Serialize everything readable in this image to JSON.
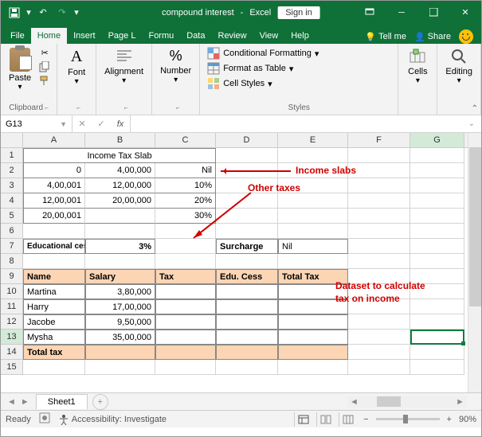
{
  "title": {
    "doc": "compound interest",
    "app": "Excel",
    "signin": "Sign in"
  },
  "tabs": {
    "file": "File",
    "home": "Home",
    "insert": "Insert",
    "pagel": "Page L",
    "formu": "Formu",
    "data": "Data",
    "review": "Review",
    "view": "View",
    "help": "Help",
    "tellme": "Tell me",
    "share": "Share"
  },
  "ribbon": {
    "clipboard": {
      "label": "Clipboard",
      "paste": "Paste"
    },
    "font": {
      "label": "Font"
    },
    "alignment": {
      "label": "Alignment"
    },
    "number": {
      "label": "Number"
    },
    "styles": {
      "label": "Styles",
      "cond": "Conditional Formatting",
      "table": "Format as Table",
      "cell": "Cell Styles"
    },
    "cells": {
      "label": "Cells"
    },
    "editing": {
      "label": "Editing"
    }
  },
  "namebox": "G13",
  "cols": {
    "A": 78,
    "B": 88,
    "C": 76,
    "D": 78,
    "E": 88,
    "F": 78,
    "G": 68
  },
  "rows": 15,
  "activeRow": 13,
  "activeCol": "G",
  "cellData": {
    "merge1": "Income Tax Slab",
    "A2": "0",
    "B2": "4,00,000",
    "C2": "Nil",
    "A3": "4,00,001",
    "B3": "12,00,000",
    "C3": "10%",
    "A4": "12,00,001",
    "B4": "20,00,000",
    "C4": "20%",
    "A5": "20,00,001",
    "C5": "30%",
    "A7": "Educational cess",
    "B7": "3%",
    "D7": "Surcharge",
    "E7": "Nil",
    "A9": "Name",
    "B9": "Salary",
    "C9": "Tax",
    "D9": "Edu. Cess",
    "E9": "Total Tax",
    "A10": "Martina",
    "B10": "3,80,000",
    "A11": "Harry",
    "B11": "17,00,000",
    "A12": "Jacobe",
    "B12": "9,50,000",
    "A13": "Mysha",
    "B13": "35,00,000",
    "A14": "Total tax"
  },
  "annotations": {
    "slabs": "Income slabs",
    "other": "Other taxes",
    "dataset": "Dataset to calculate tax on income"
  },
  "sheetTab": "Sheet1",
  "status": {
    "ready": "Ready",
    "access": "Accessibility: Investigate",
    "zoom": "90%"
  }
}
